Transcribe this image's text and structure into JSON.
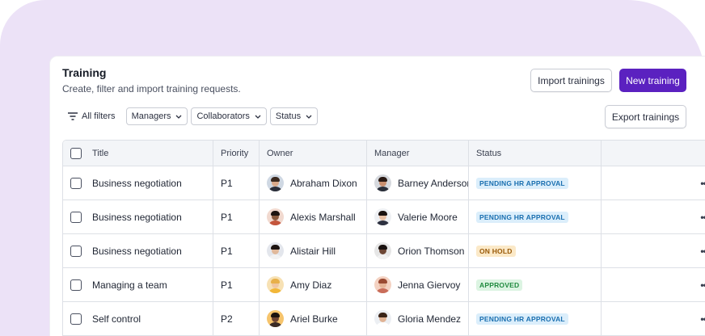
{
  "header": {
    "title": "Training",
    "subtitle": "Create, filter and import training requests."
  },
  "actions": {
    "import_label": "Import trainings",
    "new_label": "New training",
    "export_label": "Export trainings"
  },
  "filters": {
    "all_label": "All filters",
    "chips": [
      "Managers",
      "Collaborators",
      "Status"
    ]
  },
  "table": {
    "columns": [
      "Title",
      "Priority",
      "Owner",
      "Manager",
      "Status"
    ],
    "rows": [
      {
        "title": "Business negotiation",
        "priority": "P1",
        "owner": "Abraham Dixon",
        "manager": "Barney Anderson",
        "status": "PENDING HR APPROVAL",
        "status_kind": "pending"
      },
      {
        "title": "Business negotiation",
        "priority": "P1",
        "owner": "Alexis Marshall",
        "manager": "Valerie Moore",
        "status": "PENDING HR APPROVAL",
        "status_kind": "pending"
      },
      {
        "title": "Business negotiation",
        "priority": "P1",
        "owner": "Alistair Hill",
        "manager": "Orion Thomson",
        "status": "ON HOLD",
        "status_kind": "hold"
      },
      {
        "title": "Managing a team",
        "priority": "P1",
        "owner": "Amy Diaz",
        "manager": "Jenna Giervoy",
        "status": "APPROVED",
        "status_kind": "approved"
      },
      {
        "title": "Self control",
        "priority": "P2",
        "owner": "Ariel Burke",
        "manager": "Gloria Mendez",
        "status": "PENDING HR APPROVAL",
        "status_kind": "pending"
      }
    ]
  },
  "colors": {
    "background": "#ece2f7",
    "primary": "#5b21c0",
    "pending": "#1a6fb0",
    "hold": "#9a5a08",
    "approved": "#1f8a3e"
  },
  "icons": {
    "filter": "filter-icon",
    "chevron": "chevron-down-icon",
    "more": "more-horizontal-icon",
    "avatar": "avatar-icon"
  }
}
